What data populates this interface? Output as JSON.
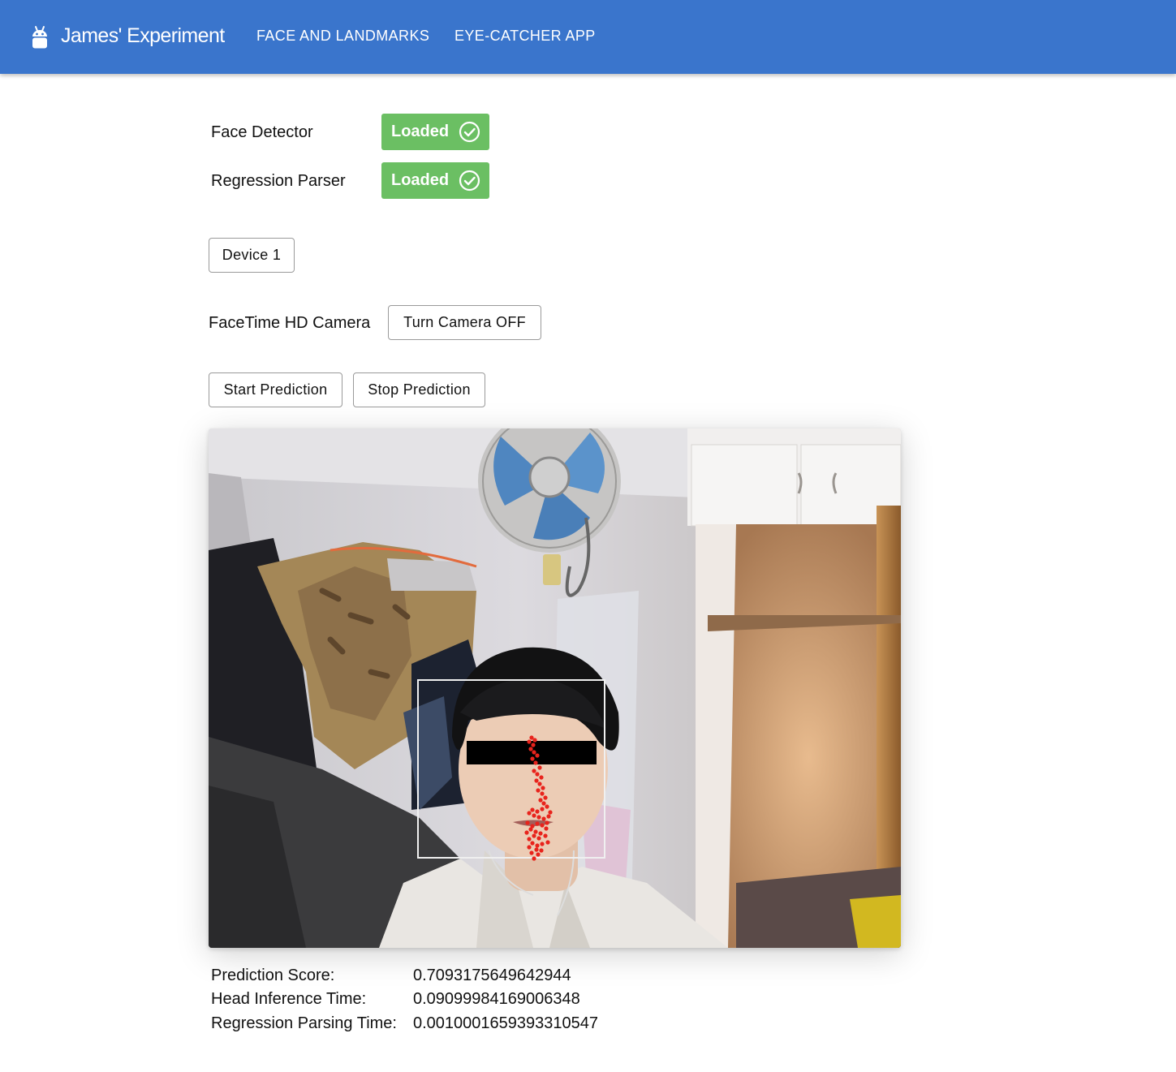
{
  "appbar": {
    "brand_icon": "android-icon",
    "title": "James' Experiment",
    "nav": [
      "FACE AND LANDMARKS",
      "EYE-CATCHER APP"
    ]
  },
  "models": [
    {
      "label": "Face Detector",
      "status": "Loaded",
      "status_icon": "check-circle-icon"
    },
    {
      "label": "Regression Parser",
      "status": "Loaded",
      "status_icon": "check-circle-icon"
    }
  ],
  "device_button": "Device 1",
  "camera": {
    "name": "FaceTime HD Camera",
    "toggle_label": "Turn Camera OFF"
  },
  "prediction_controls": {
    "start_label": "Start Prediction",
    "stop_label": "Stop Prediction"
  },
  "stats": [
    {
      "label": "Prediction Score:",
      "value": "0.7093175649642944"
    },
    {
      "label": "Head Inference Time:",
      "value": "0.09099984169006348"
    },
    {
      "label": "Regression Parsing Time:",
      "value": "0.0010001659393310547"
    }
  ],
  "colors": {
    "appbar": "#3a75cc",
    "loaded_badge": "#6bbf63",
    "landmark": "#e8231c"
  }
}
